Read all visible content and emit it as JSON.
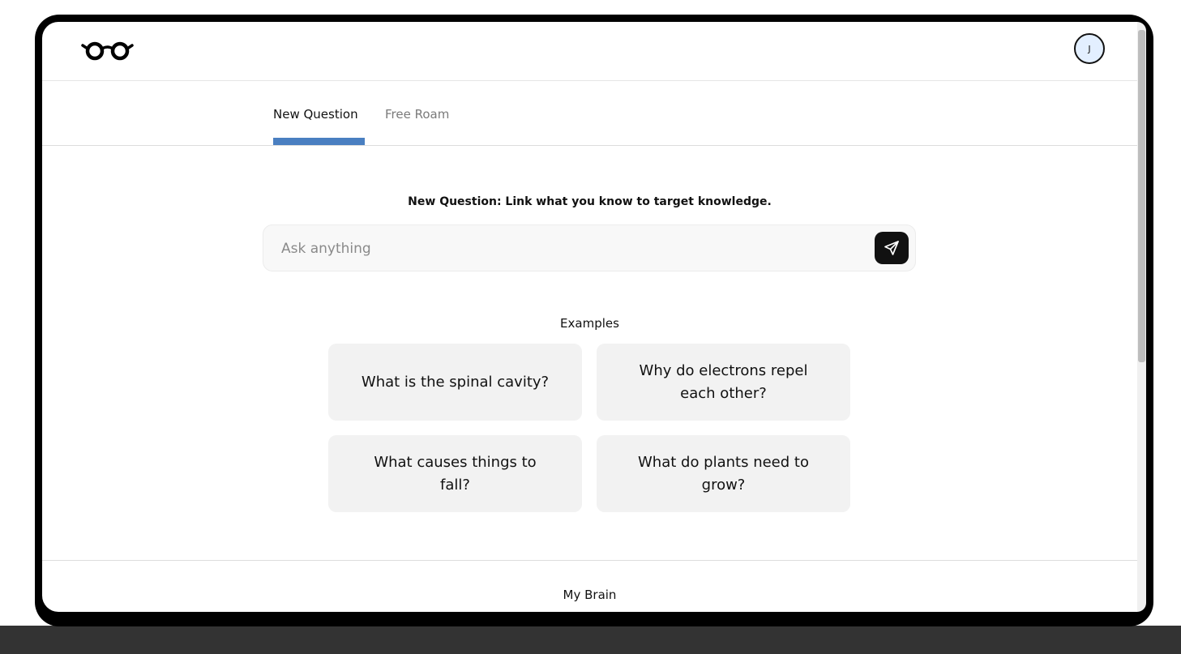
{
  "header": {
    "logo_icon": "glasses-icon",
    "avatar_initial": "J"
  },
  "tabs": [
    {
      "label": "New Question",
      "active": true
    },
    {
      "label": "Free Roam",
      "active": false
    }
  ],
  "main": {
    "heading": "New Question: Link what you know to target knowledge.",
    "search": {
      "placeholder": "Ask anything",
      "value": "",
      "send_icon": "send-icon"
    },
    "examples_label": "Examples",
    "examples": [
      "What is the spinal cavity?",
      "Why do electrons repel each other?",
      "What causes things to fall?",
      "What do plants need to grow?"
    ]
  },
  "footer_section": {
    "title": "My Brain"
  },
  "colors": {
    "tab_active_underline": "#4a7fc1",
    "avatar_bg": "#e3efff",
    "send_button_bg": "#111111",
    "card_bg": "#f2f2f2",
    "device_frame": "#000000"
  }
}
